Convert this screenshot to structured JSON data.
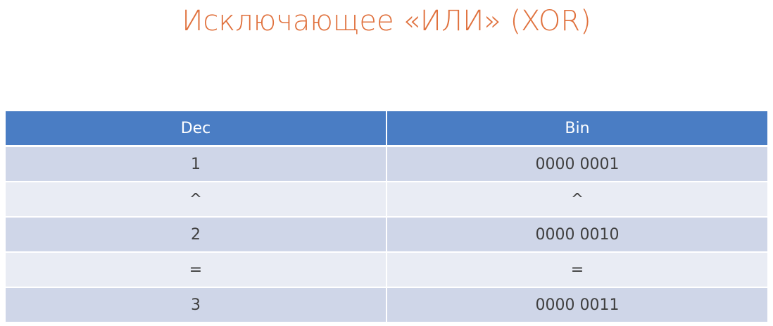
{
  "title": "Исключающее «ИЛИ» (XOR)",
  "table": {
    "headers": [
      "Dec",
      "Bin"
    ],
    "rows": [
      [
        "1",
        "0000 0001"
      ],
      [
        "^",
        "^"
      ],
      [
        "2",
        "0000 0010"
      ],
      [
        "=",
        "="
      ],
      [
        "3",
        "0000 0011"
      ]
    ]
  },
  "colors": {
    "title": "#e0713d",
    "header_bg": "#4a7dc4",
    "row_odd": "#cfd6e8",
    "row_even": "#e9ecf4"
  }
}
